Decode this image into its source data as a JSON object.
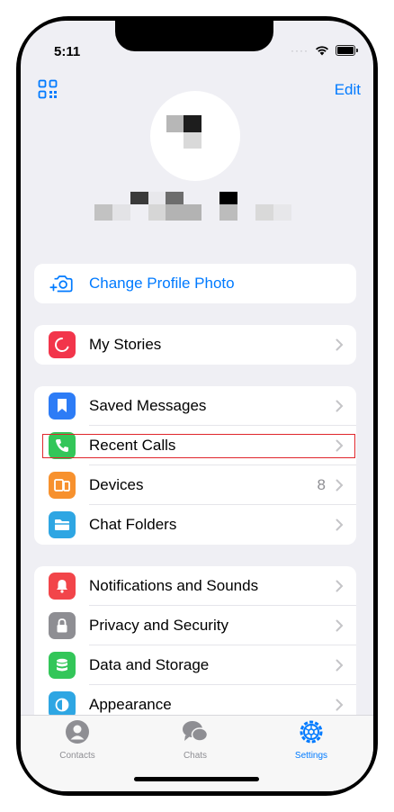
{
  "status": {
    "time": "5:11"
  },
  "header": {
    "edit_label": "Edit",
    "qr_icon": "qr-code-icon"
  },
  "profile_card": {
    "label": "Change Profile Photo"
  },
  "stories_card": {
    "items": [
      {
        "label": "My Stories",
        "color": "#f2354b"
      }
    ]
  },
  "main_card": {
    "items": [
      {
        "label": "Saved Messages",
        "color": "#2d7cf6"
      },
      {
        "label": "Recent Calls",
        "color": "#33c659"
      },
      {
        "label": "Devices",
        "color": "#f7912e",
        "value": "8"
      },
      {
        "label": "Chat Folders",
        "color": "#2ea6e3"
      }
    ]
  },
  "settings_card": {
    "items": [
      {
        "label": "Notifications and Sounds",
        "color": "#f2454a"
      },
      {
        "label": "Privacy and Security",
        "color": "#8e8e93"
      },
      {
        "label": "Data and Storage",
        "color": "#33c659"
      },
      {
        "label": "Appearance",
        "color": "#2ea6e3"
      }
    ]
  },
  "tabbar": {
    "tabs": [
      {
        "label": "Contacts",
        "active": false
      },
      {
        "label": "Chats",
        "active": false
      },
      {
        "label": "Settings",
        "active": true
      }
    ]
  },
  "colors": {
    "accent": "#007aff",
    "highlight": "#e0262c"
  }
}
